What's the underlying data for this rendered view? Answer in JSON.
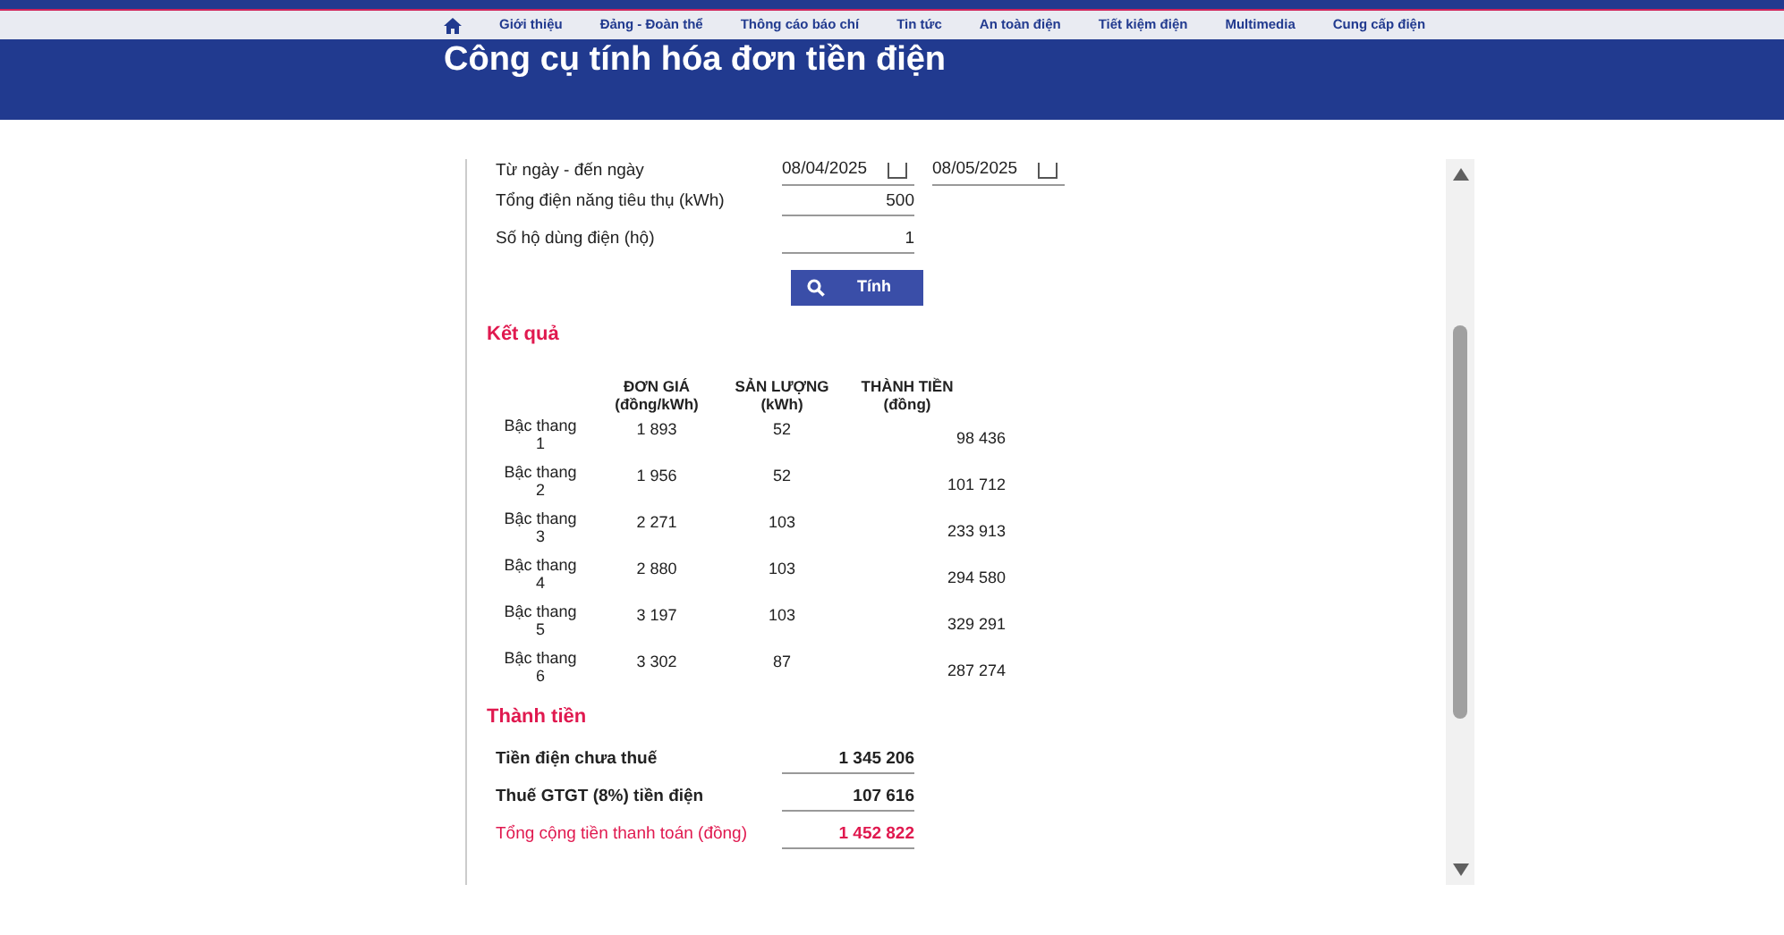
{
  "nav": {
    "items": [
      "Giới thiệu",
      "Đảng - Đoàn thể",
      "Thông cáo báo chí",
      "Tin tức",
      "An toàn điện",
      "Tiết kiệm điện",
      "Multimedia",
      "Cung cấp điện"
    ]
  },
  "page_title": "Công cụ tính hóa đơn tiền điện",
  "form": {
    "date_label": "Từ ngày - đến ngày",
    "date_from": "08/04/2025",
    "date_to": "08/05/2025",
    "fields": [
      {
        "label": "Tổng điện năng tiêu thụ (kWh)",
        "value": "500"
      },
      {
        "label": "Số hộ dùng điện (hộ)",
        "value": "1"
      }
    ],
    "button": "Tính"
  },
  "results": {
    "title": "Kết quả",
    "columns": [
      [
        "ĐƠN GIÁ",
        "(đồng/kWh)"
      ],
      [
        "SẢN LƯỢNG",
        "(kWh)"
      ],
      [
        "THÀNH TIỀN",
        "(đồng)"
      ]
    ],
    "rows": [
      {
        "tier": [
          "Bậc thang",
          "1"
        ],
        "price": "1 893",
        "quantity": "52",
        "amount": "98 436"
      },
      {
        "tier": [
          "Bậc thang",
          "2"
        ],
        "price": "1 956",
        "quantity": "52",
        "amount": "101 712"
      },
      {
        "tier": [
          "Bậc thang",
          "3"
        ],
        "price": "2 271",
        "quantity": "103",
        "amount": "233 913"
      },
      {
        "tier": [
          "Bậc thang",
          "4"
        ],
        "price": "2 880",
        "quantity": "103",
        "amount": "294 580"
      },
      {
        "tier": [
          "Bậc thang",
          "5"
        ],
        "price": "3 197",
        "quantity": "103",
        "amount": "329 291"
      },
      {
        "tier": [
          "Bậc thang",
          "6"
        ],
        "price": "3 302",
        "quantity": "87",
        "amount": "287 274"
      }
    ]
  },
  "totals": {
    "title": "Thành tiền",
    "rows": [
      {
        "label": "Tiền điện chưa thuế",
        "value": "1 345 206",
        "kind": "normal"
      },
      {
        "label": "Thuế GTGT (8%) tiền điện",
        "value": "107 616",
        "kind": "normal"
      },
      {
        "label": "Tổng cộng tiền thanh toán (đồng)",
        "value": "1 452 822",
        "kind": "grand"
      }
    ]
  }
}
